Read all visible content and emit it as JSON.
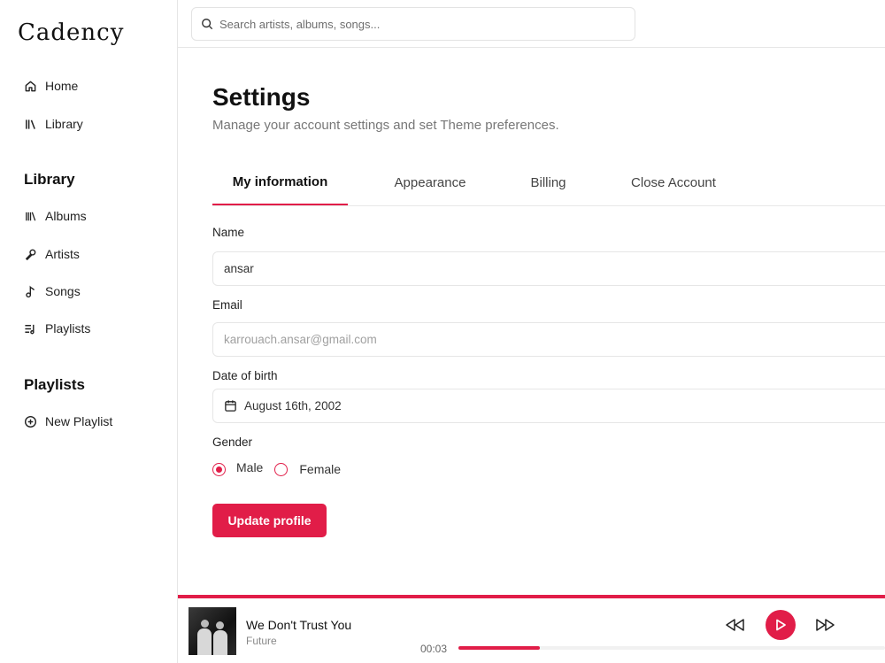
{
  "app": {
    "name": "Cadency"
  },
  "colors": {
    "accent": "#e11d48",
    "border": "#e6e6e6",
    "muted": "#777777"
  },
  "sidebar": {
    "main": [
      {
        "label": "Home",
        "icon": "home-icon"
      },
      {
        "label": "Library",
        "icon": "library-icon"
      }
    ],
    "library_heading": "Library",
    "library": [
      {
        "label": "Albums",
        "icon": "albums-icon"
      },
      {
        "label": "Artists",
        "icon": "microphone-icon"
      },
      {
        "label": "Songs",
        "icon": "music-note-icon"
      },
      {
        "label": "Playlists",
        "icon": "playlist-icon"
      }
    ],
    "playlists_heading": "Playlists",
    "playlists": [
      {
        "label": "New Playlist",
        "icon": "plus-circle-icon"
      }
    ]
  },
  "search": {
    "placeholder": "Search artists, albums, songs...",
    "value": ""
  },
  "settings": {
    "title": "Settings",
    "subtitle": "Manage your account settings and set Theme preferences.",
    "tabs": [
      {
        "label": "My information",
        "active": true
      },
      {
        "label": "Appearance",
        "active": false
      },
      {
        "label": "Billing",
        "active": false
      },
      {
        "label": "Close Account",
        "active": false
      }
    ],
    "form": {
      "name_label": "Name",
      "name_value": "ansar",
      "email_label": "Email",
      "email_value": "karrouach.ansar@gmail.com",
      "dob_label": "Date of birth",
      "dob_value": "August 16th, 2002",
      "gender_label": "Gender",
      "gender_options": [
        "Male",
        "Female"
      ],
      "gender_selected": "Male",
      "submit_label": "Update profile"
    }
  },
  "player": {
    "title": "We Don't Trust You",
    "artist": "Future",
    "elapsed": "00:03",
    "progress": 0.19
  }
}
